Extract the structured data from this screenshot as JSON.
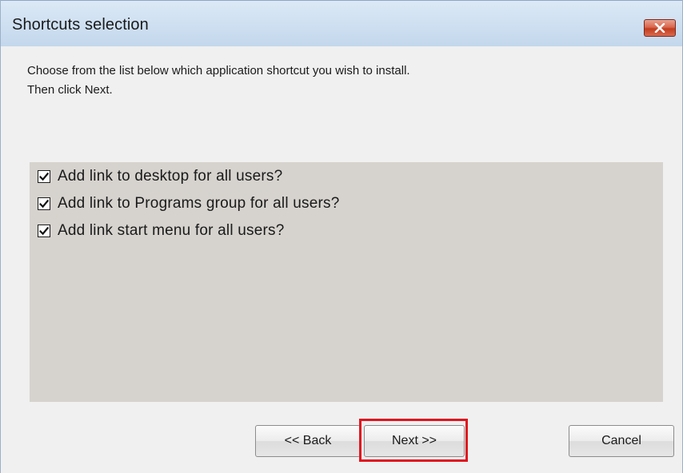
{
  "window": {
    "title": "Shortcuts selection",
    "close_icon": "close-x-icon",
    "close_color": "#c8442a"
  },
  "instructions": {
    "line1": "Choose from the list below which application shortcut you wish to install.",
    "line2": "Then click Next."
  },
  "options": [
    {
      "label": "Add link to desktop for all users?",
      "checked": true
    },
    {
      "label": "Add link to Programs group for all users?",
      "checked": true
    },
    {
      "label": "Add link start menu for all users?",
      "checked": true
    }
  ],
  "buttons": {
    "back": "<< Back",
    "next": "Next >>",
    "cancel": "Cancel"
  },
  "annotation": {
    "highlight_color": "#e0141e",
    "highlight_target": "next"
  },
  "colors": {
    "panel_bg": "#d6d3ce",
    "dialog_bg": "#f0f0f0",
    "titlebar": "#cfe0f1"
  }
}
